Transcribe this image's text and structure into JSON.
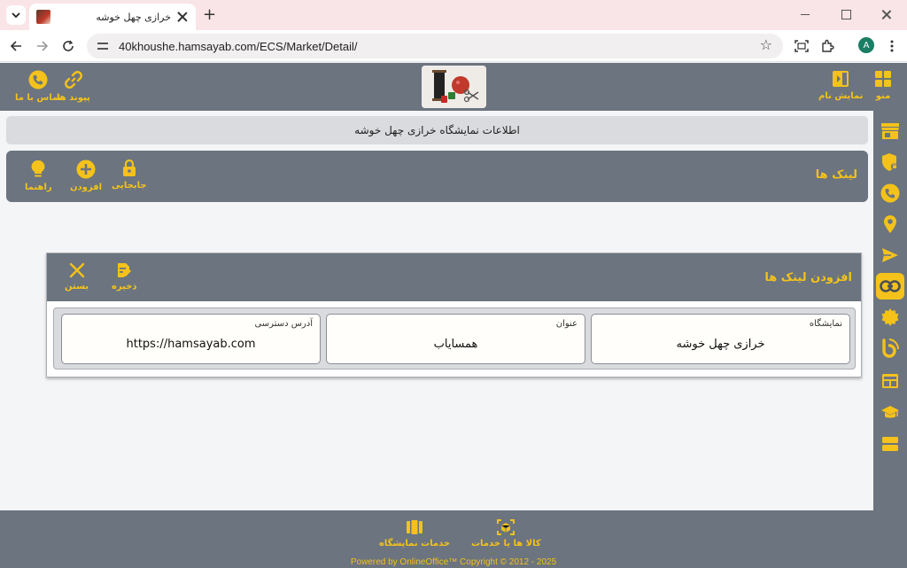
{
  "browser": {
    "tab_title": "خرازی چهل خوشه",
    "url": "40khoushe.hamsayab.com/ECS/Market/Detail/",
    "profile_initial": "A"
  },
  "header": {
    "menu_label": "منو",
    "display_name_label": "نمایش نام",
    "links_label": "پیوند ها",
    "contact_label": "تماس با ما"
  },
  "banner": {
    "text": "اطلاعات نمایشگاه خرازی چهل خوشه"
  },
  "links_section": {
    "title": "لینک ها",
    "move_label": "جابجایی",
    "add_label": "افزودن",
    "help_label": "راهنما"
  },
  "modal": {
    "title": "افزودن لینک ها",
    "save_label": "ذخیره",
    "close_label": "بستن",
    "fields": [
      {
        "label": "نمایشگاه",
        "value": "خرازی چهل خوشه"
      },
      {
        "label": "عنوان",
        "value": "همسایاب"
      },
      {
        "label": "آدرس دسترسی",
        "value": "https://hamsayab.com"
      }
    ]
  },
  "footer": {
    "products_label": "کالا ها یا خدمات",
    "services_label": "خدمات نمایشگاه",
    "powered_by": "Powered by OnlineOffice™ Copyright © 2012 - 2025"
  },
  "colors": {
    "accent": "#f4c21b",
    "panel": "#6b747f",
    "banner": "#dadbde"
  }
}
